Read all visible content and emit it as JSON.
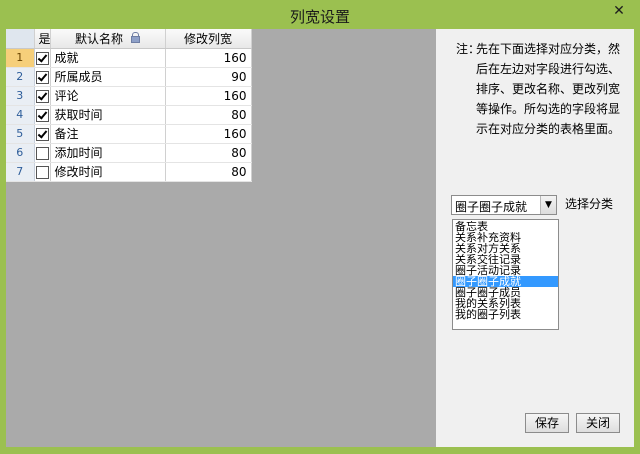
{
  "window": {
    "title": "列宽设置",
    "close_glyph": "✕"
  },
  "grid": {
    "headers": {
      "checked": "是",
      "name": "默认名称",
      "width": "修改列宽"
    },
    "rows": [
      {
        "index": "1",
        "checked": true,
        "name": "成就",
        "width": "160"
      },
      {
        "index": "2",
        "checked": true,
        "name": "所属成员",
        "width": "90"
      },
      {
        "index": "3",
        "checked": true,
        "name": "评论",
        "width": "160"
      },
      {
        "index": "4",
        "checked": true,
        "name": "获取时间",
        "width": "80"
      },
      {
        "index": "5",
        "checked": true,
        "name": "备注",
        "width": "160"
      },
      {
        "index": "6",
        "checked": false,
        "name": "添加时间",
        "width": "80"
      },
      {
        "index": "7",
        "checked": false,
        "name": "修改时间",
        "width": "80"
      }
    ],
    "current_row": 0
  },
  "note": {
    "label": "注：",
    "text": "先在下面选择对应分类，然后在左边对字段进行勾选、排序、更改名称、更改列宽等操作。所勾选的字段将显示在对应分类的表格里面。"
  },
  "category": {
    "selected": "圈子圈子成就",
    "label": "选择分类",
    "options": [
      "备忘表",
      "关系补充资料",
      "关系对方关系",
      "关系交往记录",
      "圈子活动记录",
      "圈子圈子成就",
      "圈子圈子成员",
      "我的关系列表",
      "我的圈子列表"
    ],
    "selected_index": 5
  },
  "buttons": {
    "save": "保存",
    "close": "关闭"
  }
}
